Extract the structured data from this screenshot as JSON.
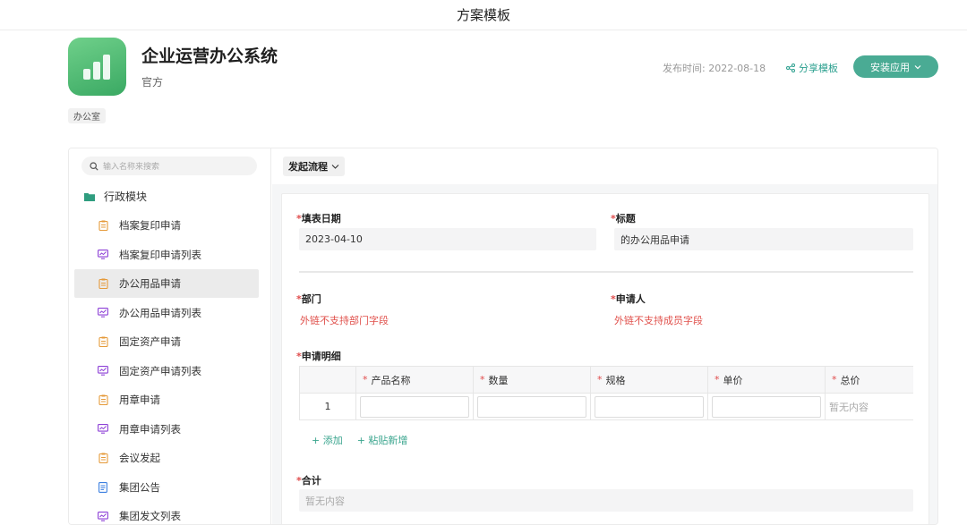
{
  "page": {
    "title": "方案模板"
  },
  "app": {
    "name": "企业运营办公系统",
    "subtitle": "官方",
    "publish_label": "发布时间: 2022-08-18",
    "share_label": "分享模板",
    "install_label": "安装应用",
    "tag": "办公室",
    "icon": "bar-chart-icon",
    "accent_color": "#4aab94"
  },
  "sidebar": {
    "search_placeholder": "输入名称来搜索",
    "folder": "行政模块",
    "items": [
      {
        "label": "档案复印申请",
        "icon": "form-icon"
      },
      {
        "label": "档案复印申请列表",
        "icon": "list-view-icon"
      },
      {
        "label": "办公用品申请",
        "icon": "form-icon",
        "active": true
      },
      {
        "label": "办公用品申请列表",
        "icon": "list-view-icon"
      },
      {
        "label": "固定资产申请",
        "icon": "form-icon"
      },
      {
        "label": "固定资产申请列表",
        "icon": "list-view-icon"
      },
      {
        "label": "用章申请",
        "icon": "form-icon"
      },
      {
        "label": "用章申请列表",
        "icon": "list-view-icon"
      },
      {
        "label": "会议发起",
        "icon": "form-icon"
      },
      {
        "label": "集团公告",
        "icon": "doc-icon"
      },
      {
        "label": "集团发文列表",
        "icon": "list-view-icon"
      }
    ]
  },
  "toolbar": {
    "flow_label": "发起流程"
  },
  "form": {
    "date_label": "填表日期",
    "date_value": "2023-04-10",
    "title_label": "标题",
    "title_value": "的办公用品申请",
    "dept_label": "部门",
    "dept_warn": "外链不支持部门字段",
    "applicant_label": "申请人",
    "applicant_warn": "外链不支持成员字段",
    "detail_label": "申请明细",
    "columns": [
      "产品名称",
      "数量",
      "规格",
      "单价",
      "总价"
    ],
    "row_index": "1",
    "total_empty": "暂无内容",
    "add_label": "+ 添加",
    "paste_label": "+ 粘贴新增",
    "sum_label": "合计",
    "sum_empty": "暂无内容"
  }
}
